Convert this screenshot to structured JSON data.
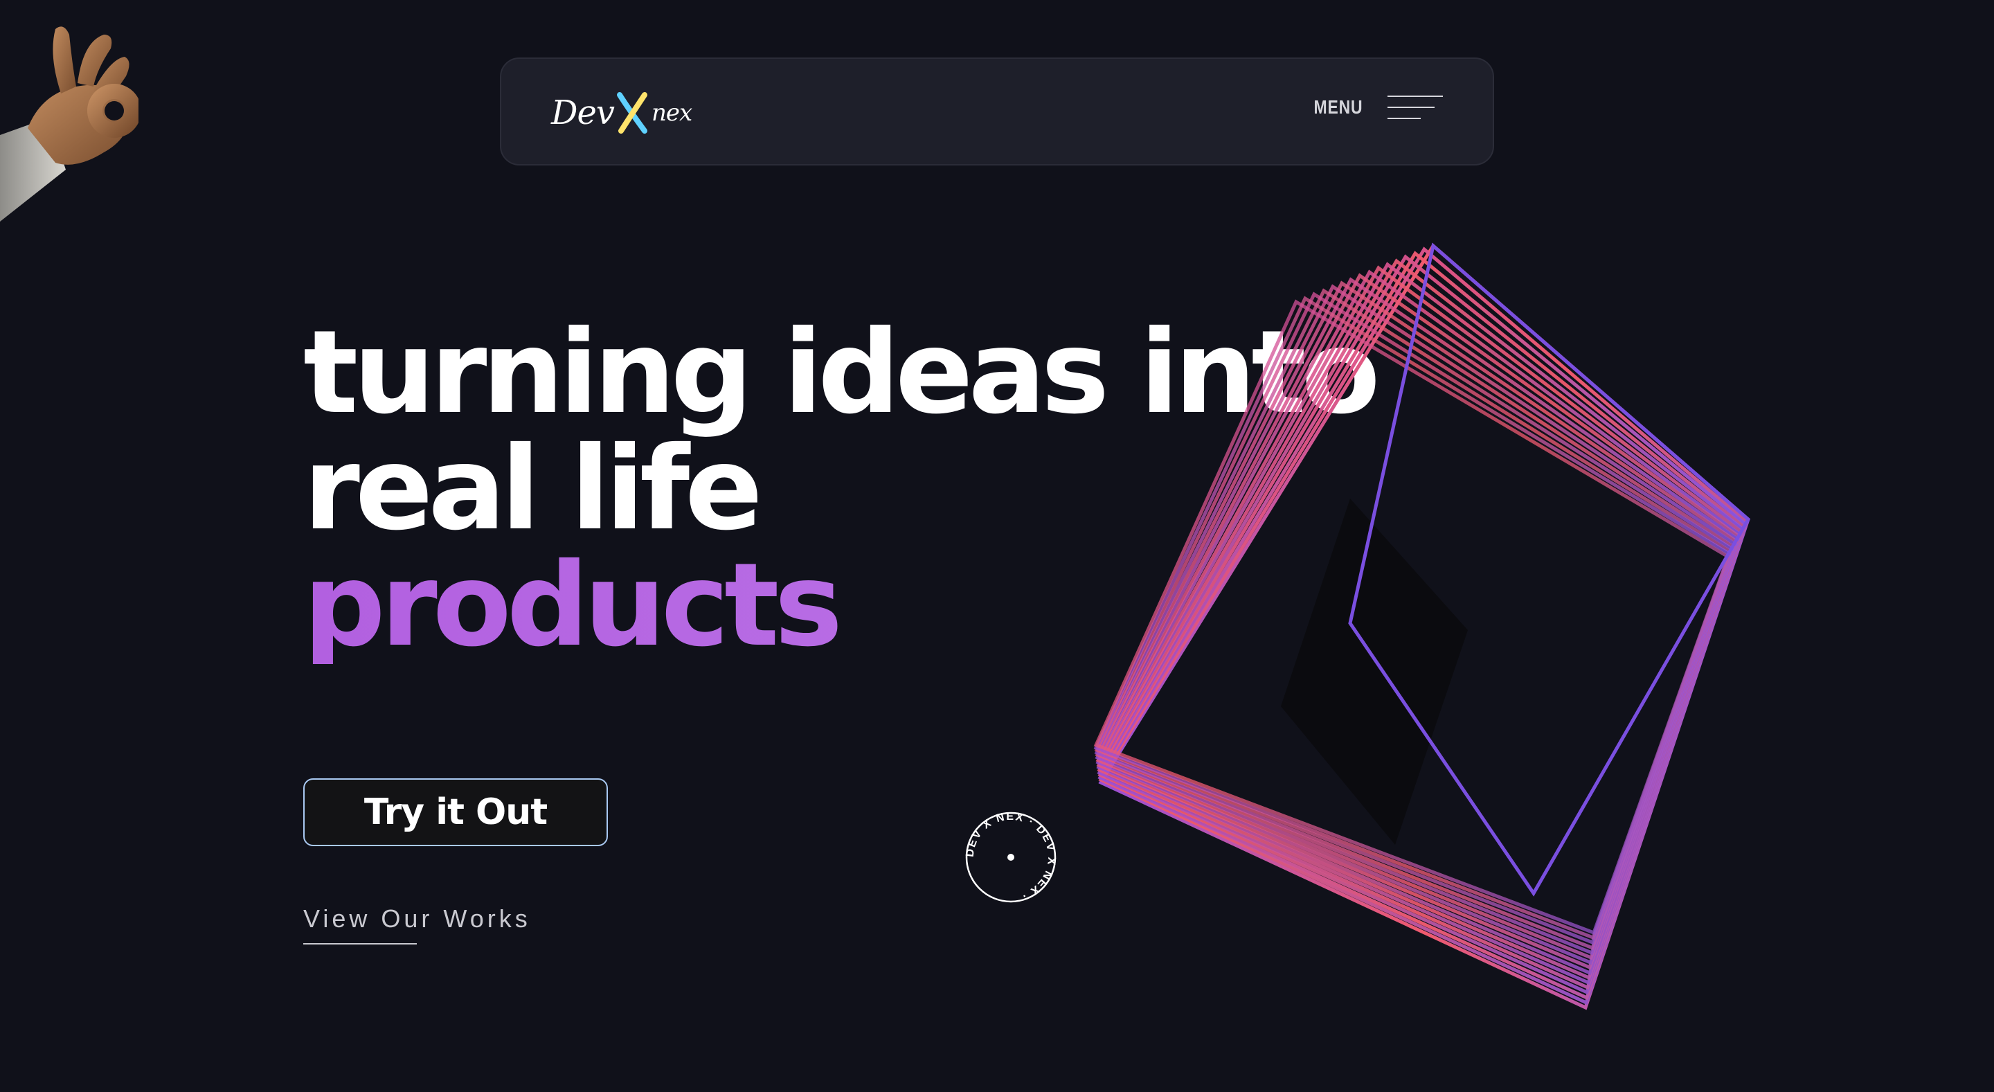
{
  "brand": {
    "logo_part1": "Dev",
    "logo_x": "X",
    "logo_part2": "nex"
  },
  "nav": {
    "menu_label": "MENU"
  },
  "hero": {
    "line1": "turning ideas into",
    "line2": "real life",
    "line3": "products"
  },
  "cta": {
    "primary_label": "Try it Out",
    "secondary_label": "View Our Works"
  },
  "badge": {
    "text": "DEV X NEX · DEV X NEX ·"
  },
  "colors": {
    "background": "#10111a",
    "navbar": "#1e1f2a",
    "accent_purple": "#b86ae4",
    "button_border": "#a9c9f2",
    "cube_purple": "#7a4fe0",
    "cube_red": "#f05a6e"
  },
  "icons": {
    "hand": "ok-hand-icon",
    "menu": "hamburger-icon",
    "logo_mark": "x-mark-icon"
  }
}
